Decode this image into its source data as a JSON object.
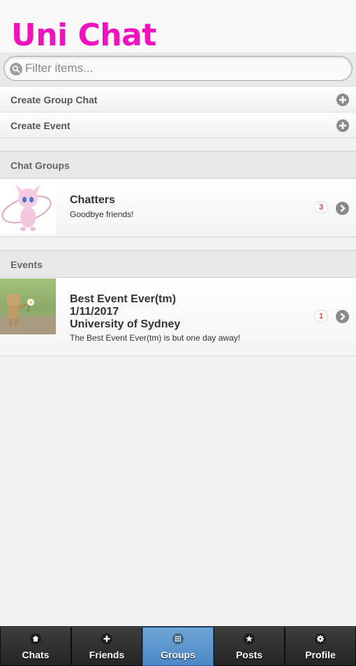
{
  "app": {
    "title": "Uni Chat"
  },
  "search": {
    "placeholder": "Filter items..."
  },
  "actions": [
    {
      "label": "Create Group Chat",
      "icon": "plus-icon"
    },
    {
      "label": "Create Event",
      "icon": "plus-icon"
    }
  ],
  "sections": {
    "chat_groups": {
      "header": "Chat Groups",
      "items": [
        {
          "title": "Chatters",
          "subtitle": "Goodbye friends!",
          "count": "3",
          "thumbnail": "pink-creature-avatar"
        }
      ]
    },
    "events": {
      "header": "Events",
      "items": [
        {
          "title_line1": "Best Event Ever(tm)",
          "title_line2": "1/11/2017",
          "title_line3": "University of Sydney",
          "subtitle": "The Best Event Ever(tm) is but one day away!",
          "count": "1",
          "thumbnail": "cardboard-robot-photo"
        }
      ]
    }
  },
  "tabbar": {
    "tabs": [
      {
        "label": "Chats",
        "icon": "home-icon",
        "active": false
      },
      {
        "label": "Friends",
        "icon": "plus-icon",
        "active": false
      },
      {
        "label": "Groups",
        "icon": "grid-icon",
        "active": true
      },
      {
        "label": "Posts",
        "icon": "star-icon",
        "active": false
      },
      {
        "label": "Profile",
        "icon": "gear-icon",
        "active": false
      }
    ]
  },
  "colors": {
    "title": "#f012be",
    "active_tab": "#5b97cd",
    "badge_text": "#cc0000"
  }
}
